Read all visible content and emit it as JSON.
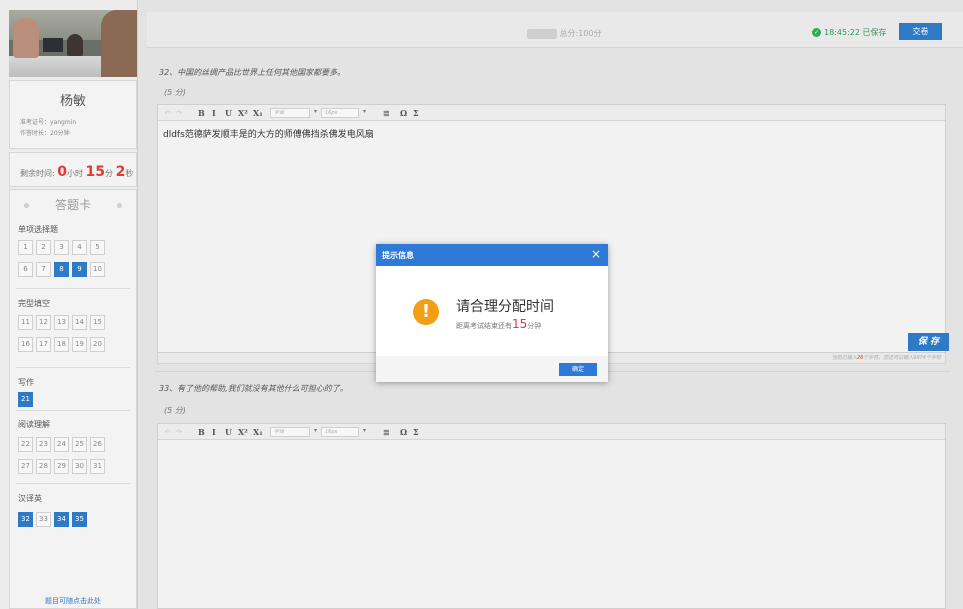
{
  "sidebar": {
    "username": "杨敏",
    "exam_id": "准考证号：yangmin",
    "duration": "作答时长：20分钟",
    "timer": {
      "label": "剩余时间:",
      "hours": "0",
      "hours_unit": "小时",
      "minutes": "15",
      "minutes_unit": "分",
      "seconds": "2",
      "seconds_unit": "秒"
    },
    "card_title": "答题卡",
    "sections": [
      {
        "label": "单项选择题",
        "rows": [
          [
            "1",
            "2",
            "3",
            "4",
            "5"
          ],
          [
            "6",
            "7",
            "8",
            "9",
            "10"
          ]
        ]
      },
      {
        "label": "完型填空",
        "rows": [
          [
            "11",
            "12",
            "13",
            "14",
            "15"
          ],
          [
            "16",
            "17",
            "18",
            "19",
            "20"
          ]
        ]
      },
      {
        "label": "写作",
        "rows": [
          [
            "21"
          ]
        ]
      },
      {
        "label": "阅读理解",
        "rows": [
          [
            "22",
            "23",
            "24",
            "25",
            "26"
          ],
          [
            "27",
            "28",
            "29",
            "30",
            "31"
          ]
        ]
      },
      {
        "label": "汉译英",
        "rows": [
          [
            "32",
            "33",
            "34",
            "35"
          ]
        ]
      }
    ],
    "answered": [
      "8",
      "9",
      "21",
      "32",
      "34",
      "35"
    ],
    "footer_link": "题目可随点击此处"
  },
  "header": {
    "score_label": "总分:",
    "score_value": "100分",
    "saved_text": "18:45:22 已保存",
    "submit_label": "交卷"
  },
  "questions": [
    {
      "text": "32、中国的丝绸产品比世界上任何其他国家都要多。",
      "points": "(5 分)",
      "content": "dldfs范德萨发顺丰是的大方的师傅佛挡杀佛发电风扇",
      "save_label": "保 存",
      "count_prefix": "当前已输入",
      "count_value": "26",
      "count_suffix": "个字符，您还可以输入9974个字符"
    },
    {
      "text": "33、有了他的帮助,我们就没有其他什么可担心的了。",
      "points": "(5 分)",
      "content": ""
    }
  ],
  "toolbar": {
    "undo": "↶",
    "redo": "↷",
    "bold": "B",
    "italic": "I",
    "underline": "U",
    "superscript": "X²",
    "subscript": "X₁",
    "font_select": "字体",
    "size_select": "16px",
    "caret": "▾",
    "special": "Ω",
    "sum": "Σ"
  },
  "modal": {
    "title": "提示信息",
    "close": "×",
    "icon": "!",
    "message": "请合理分配时间",
    "sub_prefix": "距离考试结束还有",
    "sub_value": "15",
    "sub_suffix": "分钟",
    "ok_label": "确定"
  },
  "colors": {
    "primary": "#2f7ac6",
    "warning": "#f49e16",
    "danger": "#e53935",
    "success": "#2eaa5b"
  }
}
